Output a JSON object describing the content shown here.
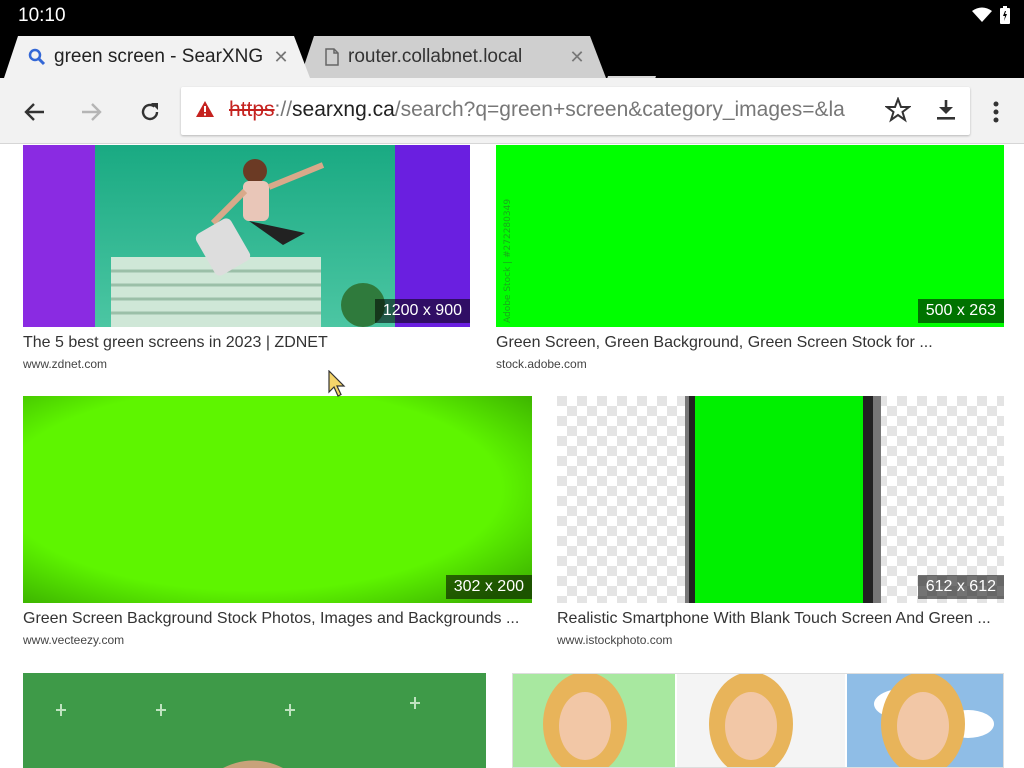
{
  "status": {
    "time": "10:10"
  },
  "tabs": [
    {
      "title": "green screen - SearXNG",
      "icon": "search-icon",
      "close": "✕",
      "active": true
    },
    {
      "title": "router.collabnet.local",
      "icon": "page-icon",
      "close": "✕",
      "active": false
    }
  ],
  "omnibox": {
    "scheme": "https",
    "sep": "://",
    "host": "searxng.ca",
    "rest": "/search?q=green+screen&category_images=&la"
  },
  "results": [
    {
      "title": "The 5 best green screens in 2023 | ZDNET",
      "url": "www.zdnet.com",
      "resolution": "1200 x 900"
    },
    {
      "title": "Green Screen, Green Background, Green Screen Stock for ...",
      "url": "stock.adobe.com",
      "resolution": "500 x 263"
    },
    {
      "title": "Green Screen Background Stock Photos, Images and Backgrounds ...",
      "url": "www.vecteezy.com",
      "resolution": "302 x 200"
    },
    {
      "title": "Realistic Smartphone With Blank Touch Screen And Green ...",
      "url": "www.istockphoto.com",
      "resolution": "612 x 612"
    }
  ],
  "colors": {
    "chroma_green": "#00ff00",
    "lime": "#5ef500",
    "teal": "#1fb88f",
    "purple": "#8a2be2"
  }
}
